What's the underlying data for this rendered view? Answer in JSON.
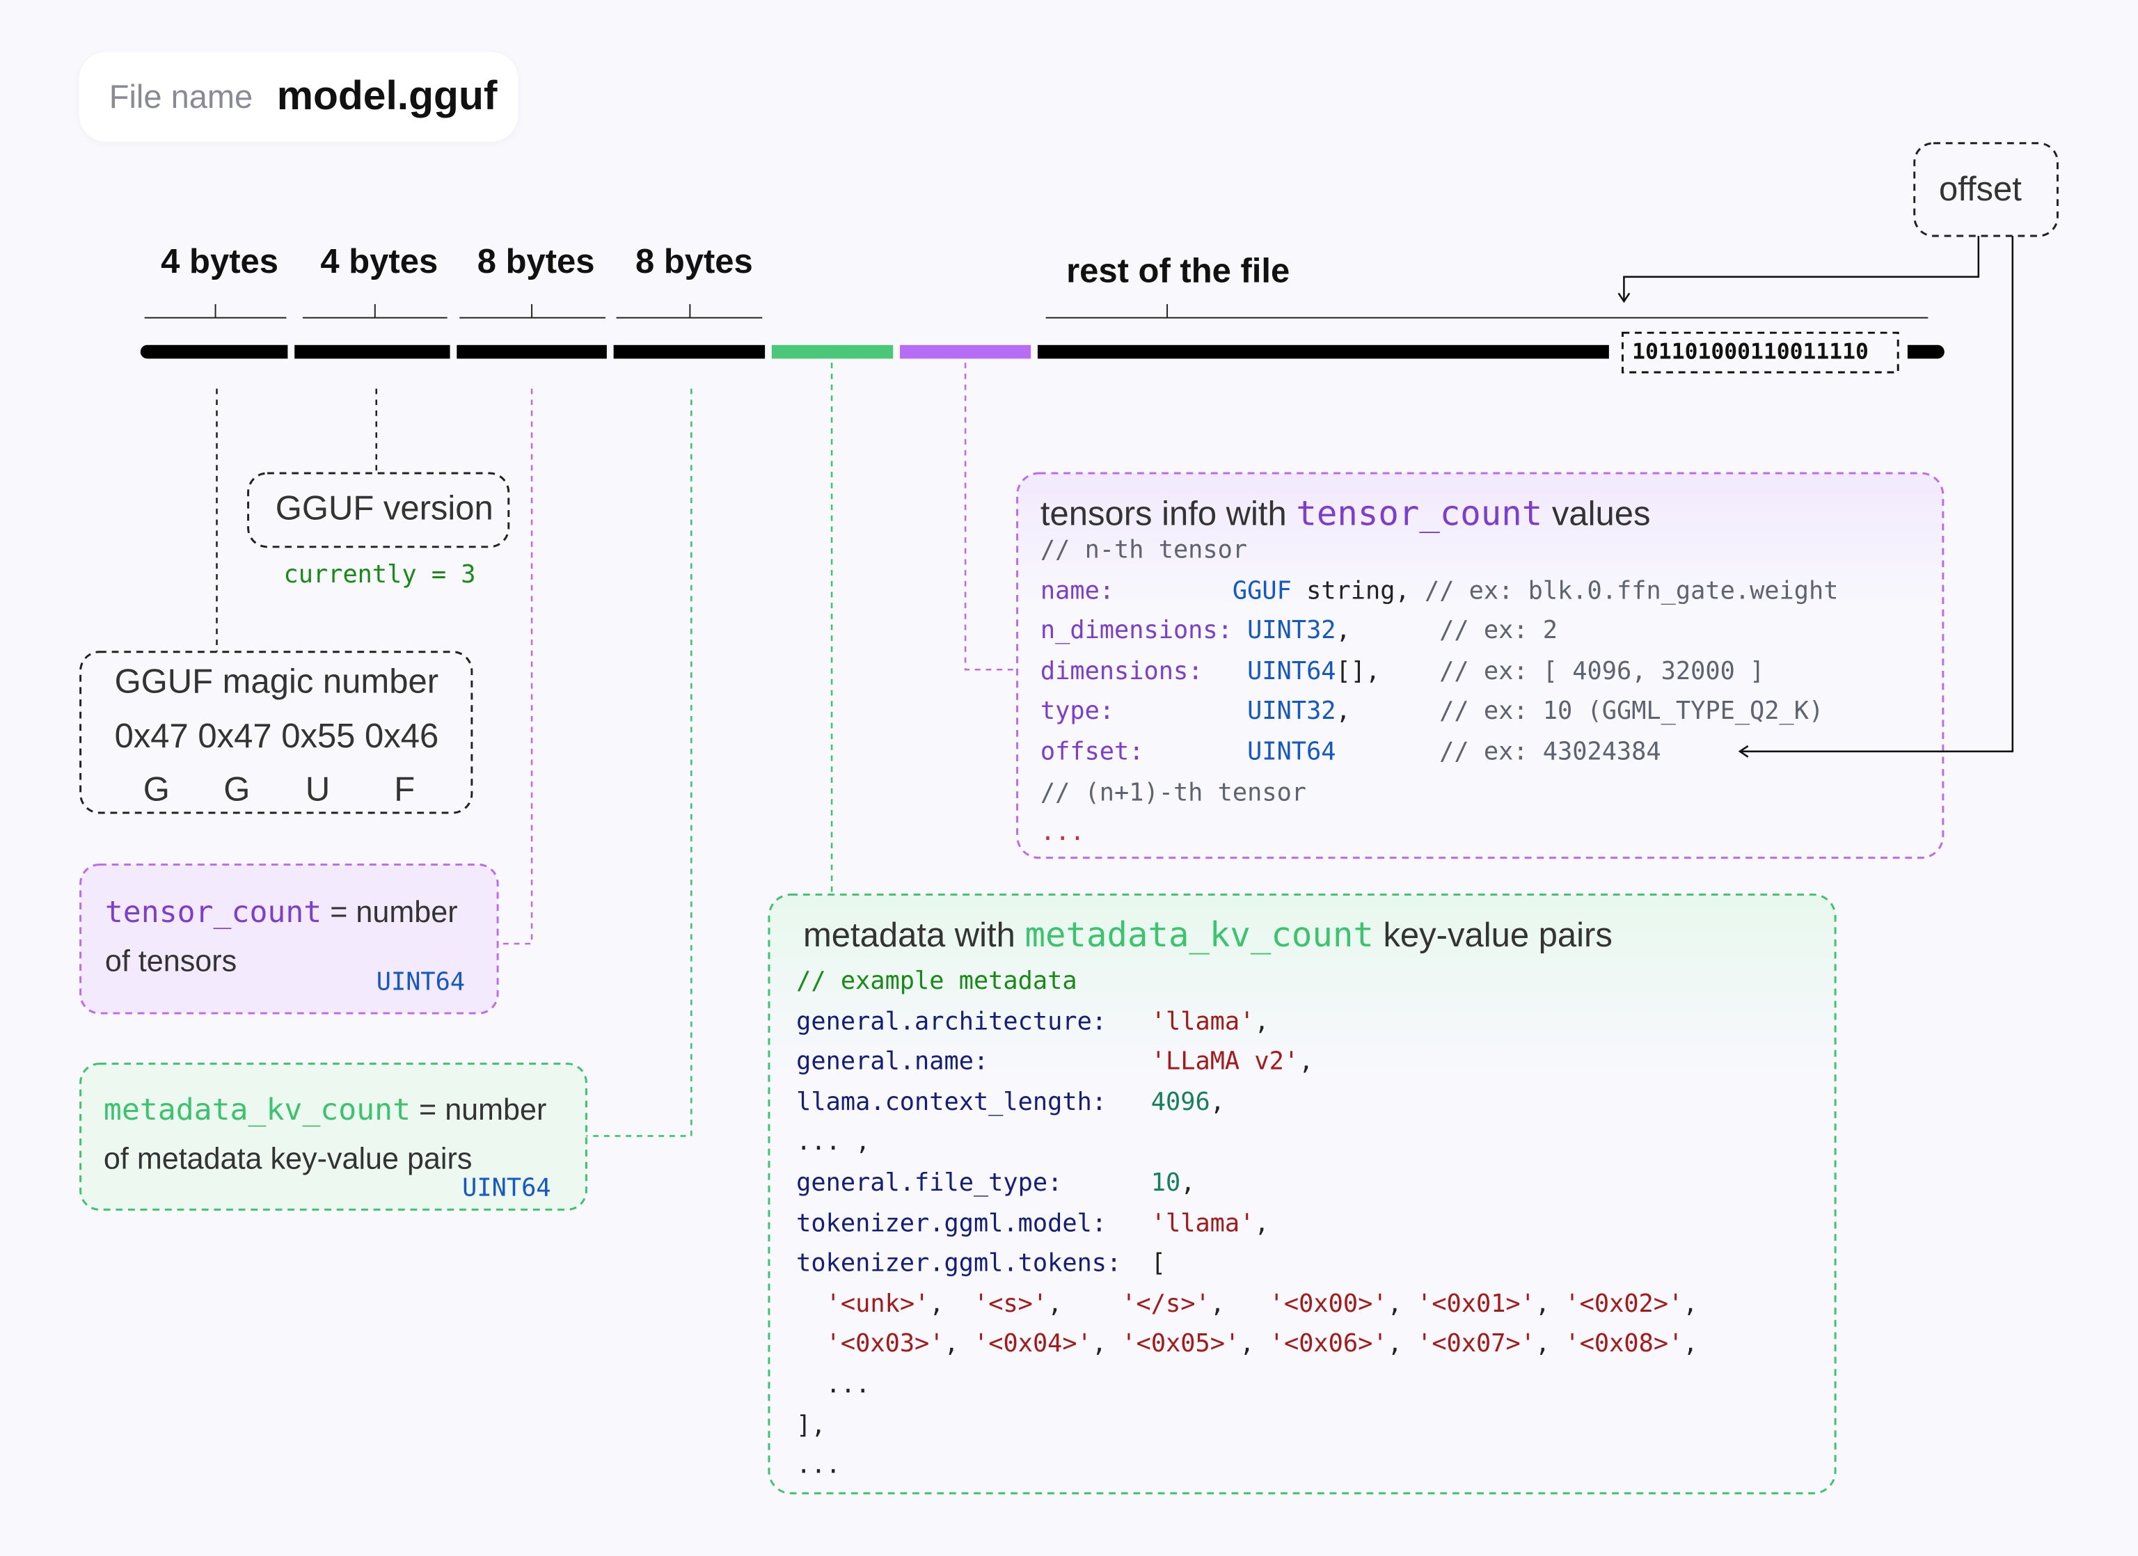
{
  "file": {
    "label": "File name",
    "name": "model.gguf"
  },
  "byte_labels": [
    "4 bytes",
    "4 bytes",
    "8 bytes",
    "8 bytes"
  ],
  "rest_label": "rest of the file",
  "binary": "101101000110011110",
  "offset_label": "offset",
  "colors": {
    "metadata": "#3cc36e",
    "tensors": "#b76cf5",
    "bar": "#000000"
  },
  "version": {
    "title": "GGUF version",
    "note": "currently = 3"
  },
  "magic": {
    "title": "GGUF magic number",
    "bytes": "0x47 0x47 0x55 0x46",
    "letters": [
      "G",
      "G",
      "U",
      "F"
    ]
  },
  "tensor_count": {
    "key": "tensor_count",
    "eq": "= number",
    "line2": "of tensors",
    "type": "UINT64"
  },
  "kv_count": {
    "key": "metadata_kv_count",
    "eq": "= number",
    "line2": "of metadata key-value pairs",
    "type": "UINT64"
  },
  "tensors_info": {
    "title_pre": "tensors info with ",
    "title_key": "tensor_count",
    "title_post": " values",
    "lines": [
      [
        [
          "// n-th tensor",
          "c-com"
        ]
      ],
      [
        [
          "name:",
          "c-key-p"
        ],
        [
          "        ",
          "c-plain"
        ],
        [
          "GGUF",
          "c-type"
        ],
        [
          " string, ",
          "c-plain"
        ],
        [
          "// ex: blk.0.ffn_gate.weight",
          "c-com"
        ]
      ],
      [
        [
          "n_dimensions:",
          "c-key-p"
        ],
        [
          " ",
          "c-plain"
        ],
        [
          "UINT32",
          "c-type"
        ],
        [
          ",      ",
          "c-plain"
        ],
        [
          "// ex: 2",
          "c-com"
        ]
      ],
      [
        [
          "dimensions:",
          "c-key-p"
        ],
        [
          "   ",
          "c-plain"
        ],
        [
          "UINT64",
          "c-type"
        ],
        [
          "[],    ",
          "c-plain"
        ],
        [
          "// ex: [ 4096, 32000 ]",
          "c-com"
        ]
      ],
      [
        [
          "type:",
          "c-key-p"
        ],
        [
          "         ",
          "c-plain"
        ],
        [
          "UINT32",
          "c-type"
        ],
        [
          ",      ",
          "c-plain"
        ],
        [
          "// ex: 10 (GGML_TYPE_Q2_K)",
          "c-com"
        ]
      ],
      [
        [
          "offset:",
          "c-key-p"
        ],
        [
          "       ",
          "c-plain"
        ],
        [
          "UINT64",
          "c-type"
        ],
        [
          "       ",
          "c-plain"
        ],
        [
          "// ex: 43024384",
          "c-com"
        ]
      ],
      [
        [
          "// (n+1)-th tensor",
          "c-com"
        ]
      ],
      [
        [
          "...",
          "c-red"
        ]
      ]
    ]
  },
  "metadata": {
    "title_pre": "metadata with ",
    "title_key": "metadata_kv_count",
    "title_post": " key-value pairs",
    "lines": [
      [
        [
          "// example metadata",
          "c-comg"
        ]
      ],
      [
        [
          "general.architecture:",
          "c-key-n"
        ],
        [
          "   ",
          "c-plain"
        ],
        [
          "'llama'",
          "c-str"
        ],
        [
          ",",
          "c-plain"
        ]
      ],
      [
        [
          "general.name:",
          "c-key-n"
        ],
        [
          "           ",
          "c-plain"
        ],
        [
          "'LLaMA v2'",
          "c-str"
        ],
        [
          ",",
          "c-plain"
        ]
      ],
      [
        [
          "llama.context_length:",
          "c-key-n"
        ],
        [
          "   ",
          "c-plain"
        ],
        [
          "4096",
          "c-num"
        ],
        [
          ",",
          "c-plain"
        ]
      ],
      [
        [
          "... ,",
          "c-plain"
        ]
      ],
      [
        [
          "general.file_type:",
          "c-key-n"
        ],
        [
          "      ",
          "c-plain"
        ],
        [
          "10",
          "c-num"
        ],
        [
          ",",
          "c-plain"
        ]
      ],
      [
        [
          "tokenizer.ggml.model:",
          "c-key-n"
        ],
        [
          "   ",
          "c-plain"
        ],
        [
          "'llama'",
          "c-str"
        ],
        [
          ",",
          "c-plain"
        ]
      ],
      [
        [
          "tokenizer.ggml.tokens:",
          "c-key-n"
        ],
        [
          "  [",
          "c-plain"
        ]
      ],
      [
        [
          "  ",
          "c-plain"
        ],
        [
          "'<unk>'",
          "c-str"
        ],
        [
          ",  ",
          "c-plain"
        ],
        [
          "'<s>'",
          "c-str"
        ],
        [
          ",    ",
          "c-plain"
        ],
        [
          "'</s>'",
          "c-str"
        ],
        [
          ",   ",
          "c-plain"
        ],
        [
          "'<0x00>'",
          "c-str"
        ],
        [
          ", ",
          "c-plain"
        ],
        [
          "'<0x01>'",
          "c-str"
        ],
        [
          ", ",
          "c-plain"
        ],
        [
          "'<0x02>'",
          "c-str"
        ],
        [
          ",",
          "c-plain"
        ]
      ],
      [
        [
          "  ",
          "c-plain"
        ],
        [
          "'<0x03>'",
          "c-str"
        ],
        [
          ", ",
          "c-plain"
        ],
        [
          "'<0x04>'",
          "c-str"
        ],
        [
          ", ",
          "c-plain"
        ],
        [
          "'<0x05>'",
          "c-str"
        ],
        [
          ", ",
          "c-plain"
        ],
        [
          "'<0x06>'",
          "c-str"
        ],
        [
          ", ",
          "c-plain"
        ],
        [
          "'<0x07>'",
          "c-str"
        ],
        [
          ", ",
          "c-plain"
        ],
        [
          "'<0x08>'",
          "c-str"
        ],
        [
          ",",
          "c-plain"
        ]
      ],
      [
        [
          "  ...",
          "c-plain"
        ]
      ],
      [
        [
          "],",
          "c-plain"
        ]
      ],
      [
        [
          "...",
          "c-plain"
        ]
      ]
    ]
  }
}
